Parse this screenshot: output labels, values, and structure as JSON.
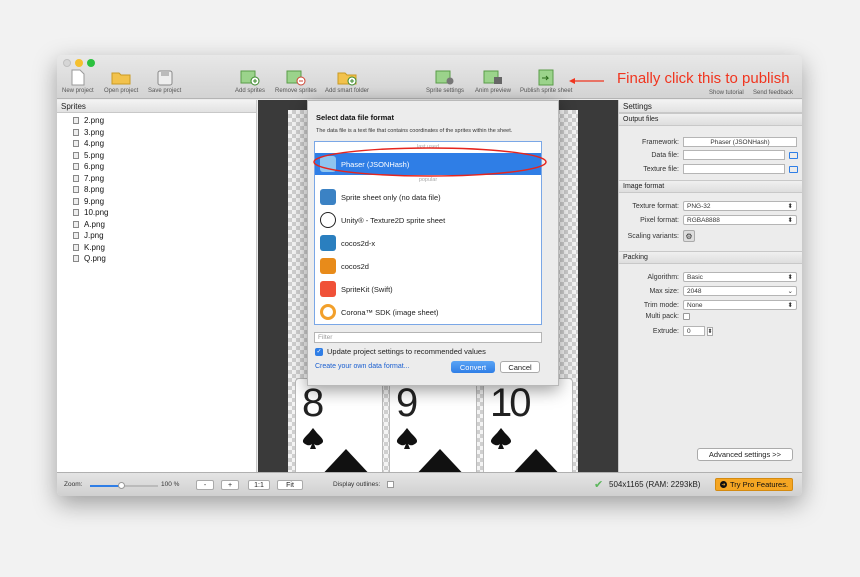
{
  "toolbar": {
    "buttons": [
      {
        "label": "New project",
        "icon": "new-project-icon"
      },
      {
        "label": "Open project",
        "icon": "folder-icon"
      },
      {
        "label": "Save project",
        "icon": "save-icon"
      },
      {
        "label": "Add sprites",
        "icon": "add-sprites-icon"
      },
      {
        "label": "Remove sprites",
        "icon": "remove-sprites-icon"
      },
      {
        "label": "Add smart folder",
        "icon": "smart-folder-icon"
      },
      {
        "label": "Sprite settings",
        "icon": "sprite-settings-icon"
      },
      {
        "label": "Anim preview",
        "icon": "anim-preview-icon"
      },
      {
        "label": "Publish sprite sheet",
        "icon": "publish-icon"
      }
    ],
    "show_tutorial": "Show tutorial",
    "send_feedback": "Send feedback"
  },
  "annotation": "Finally click this to publish",
  "sprites_panel": {
    "title": "Sprites",
    "items": [
      "2.png",
      "3.png",
      "4.png",
      "5.png",
      "6.png",
      "7.png",
      "8.png",
      "9.png",
      "10.png",
      "A.png",
      "J.png",
      "K.png",
      "Q.png"
    ]
  },
  "cards": {
    "visible_numbers": [
      "8",
      "9",
      "10"
    ]
  },
  "dialog": {
    "title": "Select data file format",
    "description": "The data file is a text file that contains coordinates of the sprites within the sheet.",
    "section_last_used": "last used",
    "section_popular": "popular",
    "items": [
      {
        "label": "Phaser (JSONHash)",
        "selected": true
      },
      {
        "label": "Sprite sheet only (no data file)"
      },
      {
        "label": "Unity® - Texture2D sprite sheet"
      },
      {
        "label": "cocos2d-x"
      },
      {
        "label": "cocos2d"
      },
      {
        "label": "SpriteKit (Swift)"
      },
      {
        "label": "Corona™ SDK (image sheet)"
      }
    ],
    "filter_placeholder": "Filter",
    "checkbox_label": "Update project settings to recommended values",
    "create_link": "Create your own data format...",
    "convert": "Convert",
    "cancel": "Cancel"
  },
  "settings": {
    "title": "Settings",
    "output_files": "Output files",
    "framework_label": "Framework:",
    "framework_value": "Phaser (JSONHash)",
    "data_file_label": "Data file:",
    "texture_file_label": "Texture file:",
    "image_format": "Image format",
    "texture_format_label": "Texture format:",
    "texture_format_value": "PNG-32",
    "pixel_format_label": "Pixel format:",
    "pixel_format_value": "RGBA8888",
    "scaling_label": "Scaling variants:",
    "packing": "Packing",
    "algorithm_label": "Algorithm:",
    "algorithm_value": "Basic",
    "max_size_label": "Max size:",
    "max_size_value": "2048",
    "trim_label": "Trim mode:",
    "trim_value": "None",
    "multipack_label": "Multi pack:",
    "extrude_label": "Extrude:",
    "extrude_value": "0",
    "advanced": "Advanced settings >>"
  },
  "statusbar": {
    "zoom_label": "Zoom:",
    "zoom_value": "100 %",
    "minus": "-",
    "plus": "+",
    "one_to_one": "1:1",
    "fit": "Fit",
    "display_outlines": "Display outlines:",
    "size_info": "504x1165 (RAM: 2293kB)",
    "try_pro": "Try Pro Features."
  },
  "colors": {
    "accent": "#2f7ee6",
    "annotation_red": "#f0351f",
    "pro_orange": "#f5a623"
  }
}
